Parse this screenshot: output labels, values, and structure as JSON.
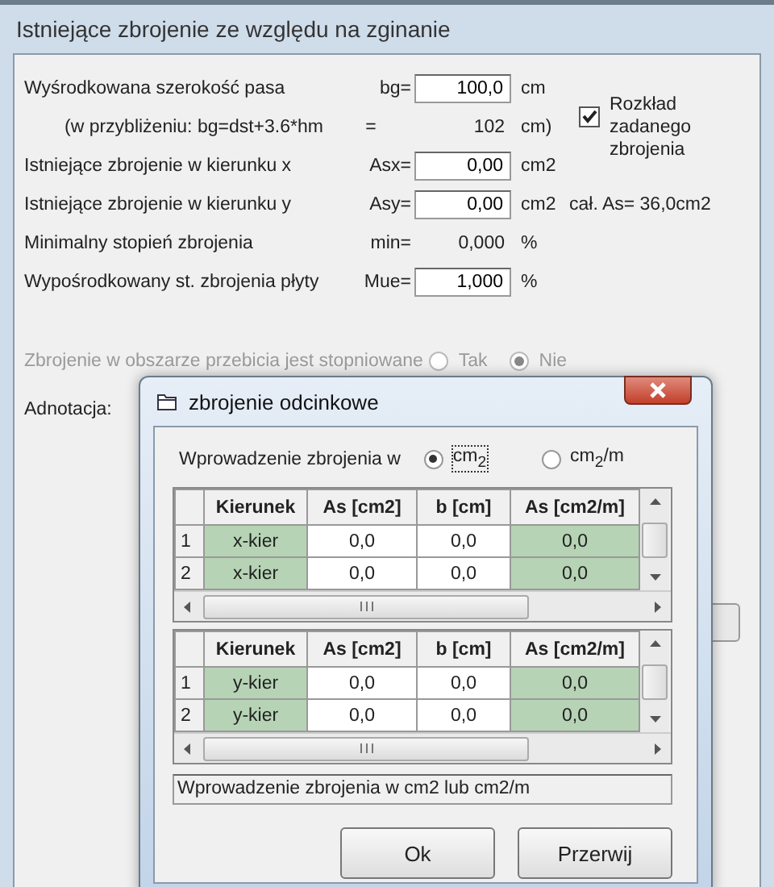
{
  "window": {
    "title": "Istniejące zbrojenie ze względu na zginanie"
  },
  "fields": [
    {
      "kind": "input",
      "label": "Wyśrodkowana szerokość pasa",
      "symbol": "bg=",
      "value": "100,0",
      "unit": "cm"
    },
    {
      "kind": "note",
      "label": "(w przybliżeniu:  bg=dst+3.6*hm",
      "symbol": "=",
      "value": "102",
      "unit": "cm)"
    },
    {
      "kind": "input",
      "label": "Istniejące zbrojenie w kierunku x",
      "symbol": "Asx=",
      "value": "0,00",
      "unit": "cm2"
    },
    {
      "kind": "input",
      "label": "Istniejące zbrojenie w kierunku y",
      "symbol": "Asy=",
      "value": "0,00",
      "unit": "cm2"
    },
    {
      "kind": "text",
      "label": "Minimalny stopień zbrojenia",
      "symbol": "min=",
      "value": "0,000",
      "unit": "%"
    },
    {
      "kind": "input",
      "label": "Wypośrodkowany st. zbrojenia płyty",
      "symbol": "Mue=",
      "value": "1,000",
      "unit": "%"
    }
  ],
  "distribution": {
    "label": "Rozkład zadanego zbrojenia",
    "checked": true
  },
  "total": "cał. As=  36,0cm2",
  "graded": {
    "label": "Zbrojenie w obszarze przebicia jest stopniowane",
    "disabled": true,
    "options": [
      {
        "label": "Tak",
        "selected": false
      },
      {
        "label": "Nie",
        "selected": true
      }
    ]
  },
  "annotation_label": "Adnotacja:",
  "dialog": {
    "title": "zbrojenie odcinkowe",
    "input_label": "Wprowadzenie zbrojenia w",
    "units": [
      {
        "label": "cm$_{2}$",
        "selected": true
      },
      {
        "label": "cm$_{2}$/m",
        "selected": false
      }
    ],
    "tables": [
      {
        "columns": [
          {
            "label": "Kierunek",
            "shaded": true
          },
          {
            "label": "As [cm2]",
            "shaded": false
          },
          {
            "label": "b [cm]",
            "shaded": false
          },
          {
            "label": "As [cm2/m]",
            "shaded": true
          }
        ],
        "rows": [
          {
            "index": "1",
            "cells": [
              "x-kier",
              "0,0",
              "0,0",
              "0,0"
            ]
          },
          {
            "index": "2",
            "cells": [
              "x-kier",
              "0,0",
              "0,0",
              "0,0"
            ]
          }
        ]
      },
      {
        "columns": [
          {
            "label": "Kierunek",
            "shaded": true
          },
          {
            "label": "As [cm2]",
            "shaded": false
          },
          {
            "label": "b [cm]",
            "shaded": false
          },
          {
            "label": "As [cm2/m]",
            "shaded": true
          }
        ],
        "rows": [
          {
            "index": "1",
            "cells": [
              "y-kier",
              "0,0",
              "0,0",
              "0,0"
            ]
          },
          {
            "index": "2",
            "cells": [
              "y-kier",
              "0,0",
              "0,0",
              "0,0"
            ]
          }
        ]
      }
    ],
    "status": "Wprowadzenie zbrojenia w cm2 lub cm2/m",
    "buttons": [
      "Ok",
      "Przerwij"
    ]
  }
}
